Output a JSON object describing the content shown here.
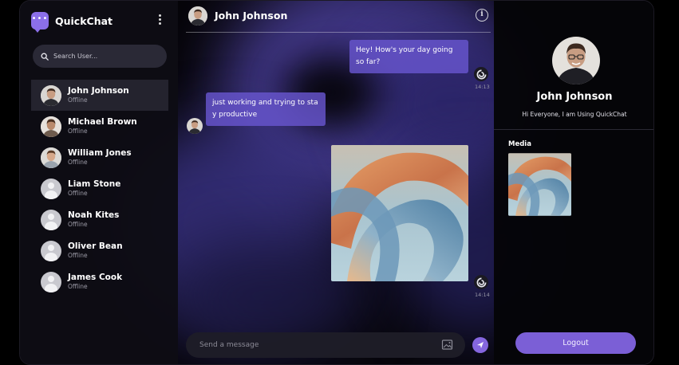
{
  "app": {
    "name": "QuickChat",
    "logo_icon": "chat-bubble-icon",
    "accent": "#8566df"
  },
  "sidebar": {
    "search_placeholder": "Search User...",
    "contacts": [
      {
        "name": "John Johnson",
        "status": "Offline",
        "avatar": "photo"
      },
      {
        "name": "Michael Brown",
        "status": "Offline",
        "avatar": "photo"
      },
      {
        "name": "William Jones",
        "status": "Offline",
        "avatar": "photo"
      },
      {
        "name": "Liam Stone",
        "status": "Offline",
        "avatar": "default"
      },
      {
        "name": "Noah Kites",
        "status": "Offline",
        "avatar": "default"
      },
      {
        "name": "Oliver Bean",
        "status": "Offline",
        "avatar": "default"
      },
      {
        "name": "James Cook",
        "status": "Offline",
        "avatar": "default"
      }
    ]
  },
  "chat": {
    "title": "John Johnson",
    "info_icon": "info-icon",
    "messages": [
      {
        "direction": "outgoing",
        "text": "Hey! How's your day going so far?",
        "time": "14:13"
      },
      {
        "direction": "incoming",
        "text": "just working and trying to sta y productive"
      },
      {
        "direction": "outgoing",
        "type": "image",
        "time": "14:14"
      }
    ],
    "input_placeholder": "Send a message"
  },
  "profile": {
    "name": "John Johnson",
    "bio": "Hi Everyone, I am Using QuickChat",
    "media_label": "Media",
    "logout_label": "Logout"
  }
}
